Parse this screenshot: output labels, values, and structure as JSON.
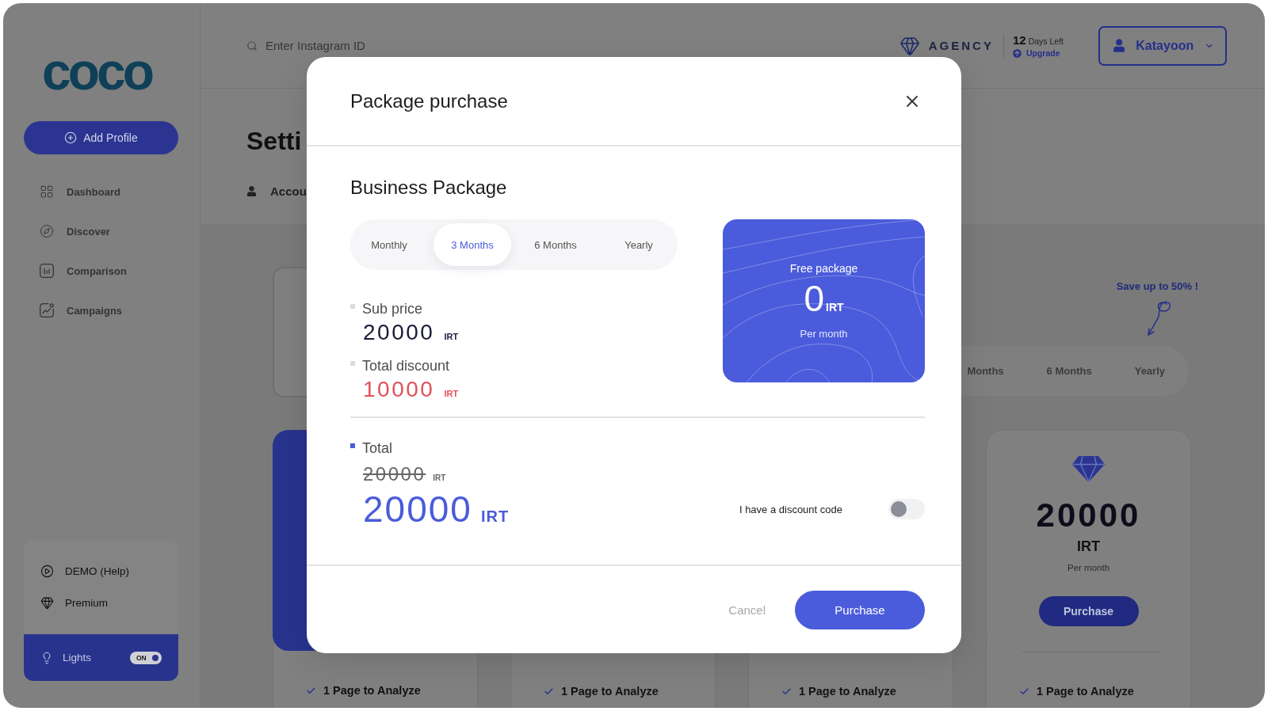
{
  "sidebar": {
    "logo": "coco",
    "add_profile": "Add Profile",
    "nav": [
      {
        "label": "Dashboard"
      },
      {
        "label": "Discover"
      },
      {
        "label": "Comparison"
      },
      {
        "label": "Campaigns"
      }
    ],
    "help": [
      {
        "label": "DEMO (Help)"
      },
      {
        "label": "Premium"
      }
    ],
    "lights": {
      "label": "Lights",
      "toggle": "ON",
      "on": true
    }
  },
  "header": {
    "search": {
      "placeholder": "Enter Instagram ID"
    },
    "plan": "AGENCY",
    "days_count": "12",
    "days_label": "Days Left",
    "upgrade": "Upgrade",
    "user": "Katayoon"
  },
  "page": {
    "title": "Setti",
    "account_tab": "Accou",
    "promo": "Save up to 50% !",
    "periods": [
      {
        "label": "Months"
      },
      {
        "label": "6 Months"
      },
      {
        "label": "Yearly"
      }
    ],
    "cards": [
      {
        "kind": "featured",
        "feature": "1 Page to Analyze"
      },
      {
        "kind": "plain",
        "feature": "1 Page to Analyze"
      },
      {
        "kind": "plain",
        "feature": "1 Page to Analyze"
      },
      {
        "kind": "priced",
        "price": "20000",
        "currency": "IRT",
        "period": "Per month",
        "button": "Purchase",
        "feature": "1 Page to Analyze"
      }
    ]
  },
  "modal": {
    "title": "Package purchase",
    "package": "Business Package",
    "periods": [
      {
        "label": "Monthly",
        "selected": false
      },
      {
        "label": "3 Months",
        "selected": true
      },
      {
        "label": "6 Months",
        "selected": false
      },
      {
        "label": "Yearly",
        "selected": false
      }
    ],
    "prices": [
      {
        "kind": "price",
        "label": "Sub price",
        "amount": "20000",
        "currency": "IRT"
      },
      {
        "kind": "discount",
        "label": "Total discount",
        "amount": "10000",
        "currency": "IRT"
      }
    ],
    "plan_card": {
      "label": "Free package",
      "amount": "0",
      "currency": "IRT",
      "period": "Per month"
    },
    "total": {
      "label": "Total",
      "old_amount": "20000",
      "old_currency": "IRT",
      "amount": "20000",
      "currency": "IRT"
    },
    "discount_code": {
      "label": "I have a discount code",
      "on": false
    },
    "cancel": "Cancel",
    "purchase": "Purchase"
  }
}
